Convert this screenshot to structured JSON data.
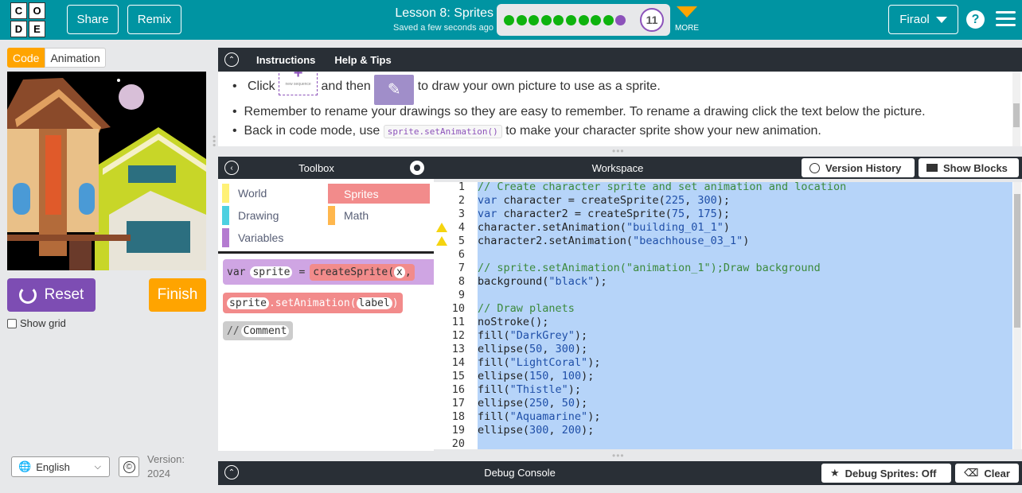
{
  "header": {
    "logo_letters": [
      "C",
      "O",
      "D",
      "E"
    ],
    "share_label": "Share",
    "remix_label": "Remix",
    "lesson_title": "Lesson 8: Sprites",
    "saved_status": "Saved a few seconds ago",
    "progress": {
      "completed_dots": 9,
      "current_level": "11"
    },
    "more_label": "MORE",
    "user_name": "Firaol",
    "help_label": "?"
  },
  "left": {
    "tabs": [
      "Code",
      "Animation"
    ],
    "reset_label": "Reset",
    "finish_label": "Finish",
    "show_grid_label": "Show grid",
    "language": "English",
    "copyright_symbol": "©",
    "version_label": "Version:",
    "version_value": "2024"
  },
  "instructions": {
    "tabs": [
      "Instructions",
      "Help & Tips"
    ],
    "bullet1_pre": "Click",
    "bullet1_mid": "and then",
    "bullet1_post": "to draw your own picture to use as a sprite.",
    "newseq_caption": "new sequence",
    "bullet2": "Remember to rename your drawings so they are easy to remember. To rename a drawing click the text below the picture.",
    "bullet3_pre": "Back in code mode, use",
    "bullet3_code": "sprite.setAnimation()",
    "bullet3_post": "to make your character sprite show your new animation."
  },
  "toolbox": {
    "title": "Toolbox",
    "categories": [
      {
        "label": "World",
        "color": "#fff176"
      },
      {
        "label": "Sprites",
        "color": "#f28b8b"
      },
      {
        "label": "Drawing",
        "color": "#4dd0e1"
      },
      {
        "label": "Math",
        "color": "#ffb74d"
      },
      {
        "label": "Variables",
        "color": "#b47bd0"
      }
    ],
    "blocks": {
      "var_kw": "var",
      "var_name": "sprite",
      "eq": "=",
      "create_fn": "createSprite(",
      "arg_x": "x",
      "comma": ",",
      "sprite2": "sprite",
      "setanim": ".setAnimation(",
      "label_arg": "label",
      "close": ")",
      "comment_slash": "//",
      "comment_label": "Comment"
    }
  },
  "workspace": {
    "title": "Workspace",
    "version_history_label": "Version History",
    "show_blocks_label": "Show Blocks",
    "warnings_on_lines": [
      4,
      5
    ],
    "lines": [
      {
        "n": "1",
        "text": "// Create character sprite and set animation and location",
        "style": "cmt"
      },
      {
        "n": "2",
        "text": "var character = createSprite(225, 300);",
        "style": "code"
      },
      {
        "n": "3",
        "text": "var character2 = createSprite(75, 175);",
        "style": "code"
      },
      {
        "n": "4",
        "text": "character.setAnimation(\"building_01_1\")",
        "style": "code"
      },
      {
        "n": "5",
        "text": "character2.setAnimation(\"beachhouse_03_1\")",
        "style": "code"
      },
      {
        "n": "6",
        "text": "",
        "style": "code"
      },
      {
        "n": "7",
        "text": "// sprite.setAnimation(\"animation_1\");Draw background",
        "style": "cmt"
      },
      {
        "n": "8",
        "text": "background(\"black\");",
        "style": "code"
      },
      {
        "n": "9",
        "text": "",
        "style": "code"
      },
      {
        "n": "10",
        "text": "// Draw planets",
        "style": "cmt"
      },
      {
        "n": "11",
        "text": "noStroke();",
        "style": "code"
      },
      {
        "n": "12",
        "text": "fill(\"DarkGrey\");",
        "style": "code"
      },
      {
        "n": "13",
        "text": "ellipse(50, 300);",
        "style": "code"
      },
      {
        "n": "14",
        "text": "fill(\"LightCoral\");",
        "style": "code"
      },
      {
        "n": "15",
        "text": "ellipse(150, 100);",
        "style": "code"
      },
      {
        "n": "16",
        "text": "fill(\"Thistle\");",
        "style": "code"
      },
      {
        "n": "17",
        "text": "ellipse(250, 50);",
        "style": "code"
      },
      {
        "n": "18",
        "text": "fill(\"Aquamarine\");",
        "style": "code"
      },
      {
        "n": "19",
        "text": "ellipse(300, 200);",
        "style": "code"
      },
      {
        "n": "20",
        "text": "",
        "style": "code"
      }
    ]
  },
  "debug": {
    "title": "Debug Console",
    "debug_sprites_label": "Debug Sprites: Off",
    "clear_label": "Clear"
  },
  "colors": {
    "header": "#0094a2",
    "dark_bar": "#292f36",
    "orange": "#ffa400",
    "purple": "#7d4db3",
    "green_dot": "#0eb30e",
    "selection": "#b6d4f9"
  }
}
